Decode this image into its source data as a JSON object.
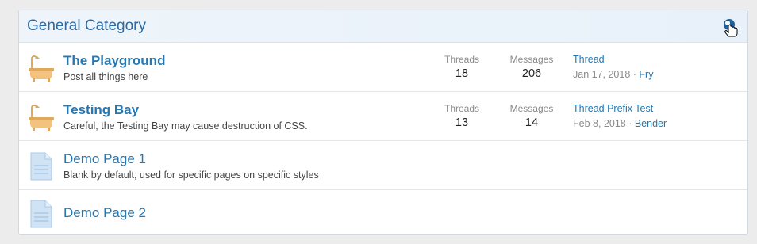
{
  "category": {
    "title": "General Category",
    "toggle_icon": "collapse-toggle-icon"
  },
  "nodes": [
    {
      "title": "The Playground",
      "description": "Post all things here",
      "icon": "bathtub-icon",
      "threads_label": "Threads",
      "threads": "18",
      "messages_label": "Messages",
      "messages": "206",
      "last_thread": "Thread",
      "last_date": "Jan 17, 2018",
      "separator": " · ",
      "last_user": "Fry"
    },
    {
      "title": "Testing Bay",
      "description": "Careful, the Testing Bay may cause destruction of CSS.",
      "icon": "bathtub-icon",
      "threads_label": "Threads",
      "threads": "13",
      "messages_label": "Messages",
      "messages": "14",
      "last_thread": "Thread Prefix Test",
      "last_date": "Feb 8, 2018",
      "separator": " · ",
      "last_user": "Bender"
    },
    {
      "title": "Demo Page 1",
      "description": "Blank by default, used for specific pages on specific styles",
      "icon": "document-icon"
    },
    {
      "title": "Demo Page 2",
      "icon": "document-icon"
    }
  ],
  "colors": {
    "link": "#2577b1",
    "header_title": "#2b6aa3",
    "bathtub": "#f2c27e",
    "document": "#cfe3f5"
  }
}
